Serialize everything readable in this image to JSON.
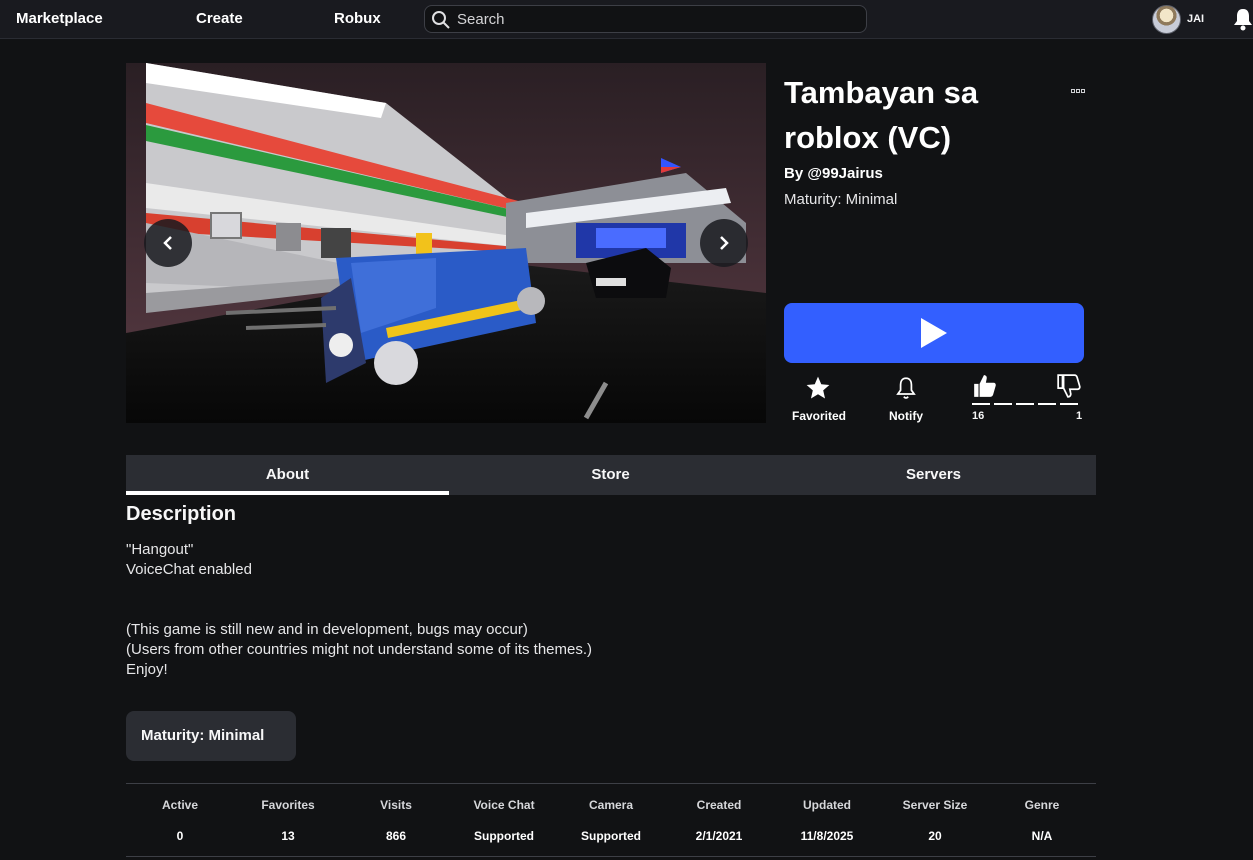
{
  "nav": {
    "marketplace": "Marketplace",
    "create": "Create",
    "robux": "Robux",
    "search_placeholder": "Search",
    "username": "JAI"
  },
  "game": {
    "title": "Tambayan sa roblox (VC)",
    "by_label": "By",
    "creator": "@99Jairus",
    "maturity": "Maturity: Minimal"
  },
  "actions": {
    "favorite_label": "Favorited",
    "notify_label": "Notify",
    "upvotes": "16",
    "downvotes": "1",
    "upvote_ratio": 0.94
  },
  "tabs": [
    "About",
    "Store",
    "Servers"
  ],
  "description": {
    "heading": "Description",
    "text": "\"Hangout\"\nVoiceChat enabled\n\n\n(This game is still new and in development, bugs may occur)\n(Users from other countries might not understand some of its themes.)\nEnjoy!"
  },
  "maturity_pill": "Maturity: Minimal",
  "stats": [
    {
      "label": "Active",
      "value": "0"
    },
    {
      "label": "Favorites",
      "value": "13"
    },
    {
      "label": "Visits",
      "value": "866"
    },
    {
      "label": "Voice Chat",
      "value": "Supported"
    },
    {
      "label": "Camera",
      "value": "Supported"
    },
    {
      "label": "Created",
      "value": "2/1/2021"
    },
    {
      "label": "Updated",
      "value": "11/8/2025"
    },
    {
      "label": "Server Size",
      "value": "20"
    },
    {
      "label": "Genre",
      "value": "N/A"
    }
  ],
  "colors": {
    "background": "#111214",
    "topbar": "#191a1f",
    "play_button": "#335fff",
    "panel": "#2b2d33"
  }
}
